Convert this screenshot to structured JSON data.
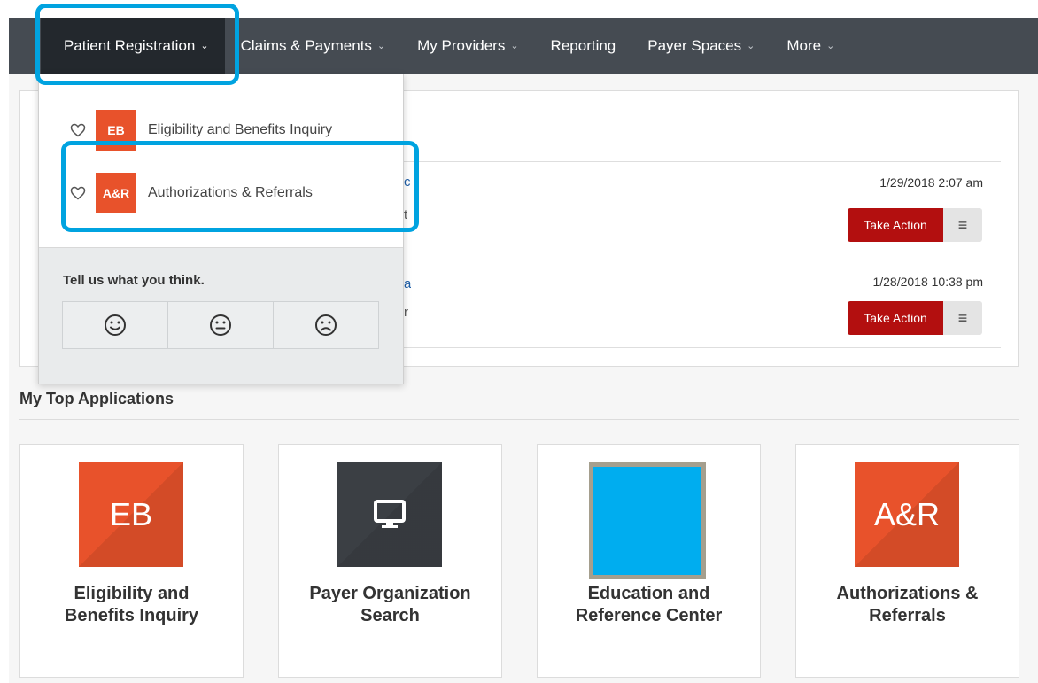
{
  "nav": {
    "items": [
      {
        "label": "Patient Registration",
        "active": true,
        "has_chevron": true
      },
      {
        "label": "Claims & Payments",
        "has_chevron": true
      },
      {
        "label": "My Providers",
        "has_chevron": true
      },
      {
        "label": "Reporting",
        "has_chevron": false
      },
      {
        "label": "Payer Spaces",
        "has_chevron": true
      },
      {
        "label": "More",
        "has_chevron": true
      }
    ],
    "chevron": "⌄"
  },
  "dropdown": {
    "items": [
      {
        "badge": "EB",
        "label": "Eligibility and Benefits Inquiry",
        "icon": "heart-outline-icon"
      },
      {
        "badge": "A&R",
        "label": "Authorizations & Referrals",
        "icon": "heart-outline-icon"
      }
    ],
    "feedback": {
      "title": "Tell us what you think.",
      "faces": [
        "smile-face-icon",
        "neutral-face-icon",
        "frown-face-icon"
      ]
    }
  },
  "notifications": [
    {
      "partial_link": "c",
      "partial_text": "t",
      "timestamp": "1/29/2018 2:07 am",
      "action_label": "Take Action",
      "menu_glyph": "≡"
    },
    {
      "partial_link": "a",
      "partial_text": "r",
      "timestamp": "1/28/2018 10:38 pm",
      "action_label": "Take Action",
      "menu_glyph": "≡"
    }
  ],
  "top_apps": {
    "title": "My Top Applications",
    "apps": [
      {
        "tile_text": "EB",
        "name": "Eligibility and Benefits Inquiry",
        "color": "#e8522b"
      },
      {
        "tile_text": "",
        "name": "Payer Organization Search",
        "color": "#3b3f44",
        "icon": "monitor-icon"
      },
      {
        "tile_text": "",
        "name": "Education and Reference Center",
        "color": "#00adef",
        "border": "#a59f8e"
      },
      {
        "tile_text": "A&R",
        "name": "Authorizations & Referrals",
        "color": "#e8522b"
      }
    ]
  },
  "colors": {
    "nav_bg": "#454b52",
    "nav_active": "#23282d",
    "highlight": "#00a3e0",
    "accent_orange": "#e8522b",
    "action_red": "#b30f0f"
  }
}
